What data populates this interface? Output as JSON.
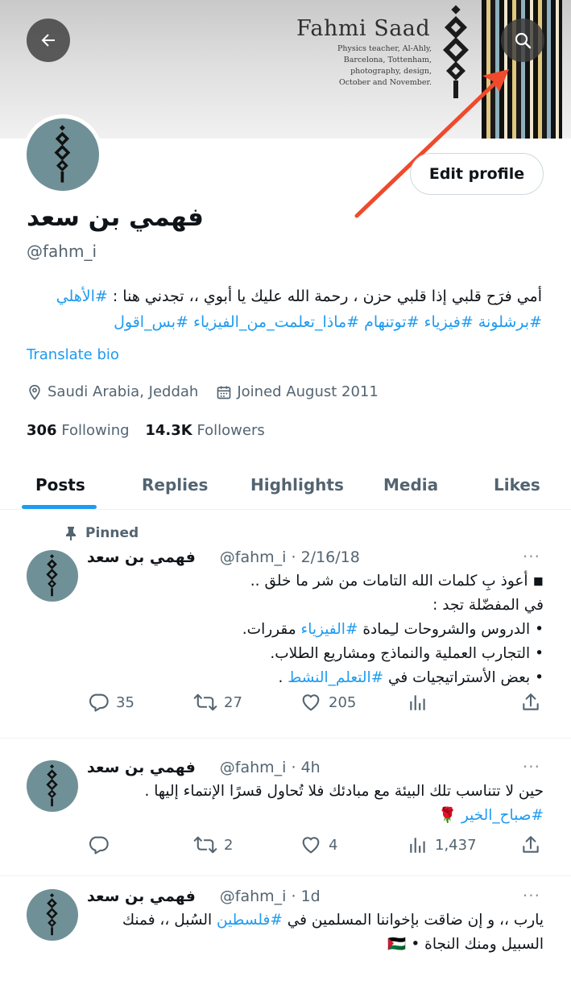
{
  "banner": {
    "name": "Fahmi Saad",
    "subtitle_lines": [
      "Physics teacher, Al-Ahly,",
      "Barcelona, Tottenham,",
      "photography, design,",
      "October and November."
    ]
  },
  "profile": {
    "edit_label": "Edit profile",
    "display_name": "فهمي بن سعد",
    "handle": "@fahm_i",
    "bio_line1_text": "أمي فرَح قلبي إذا قلبي حزن ، رحمة الله عليك يا أبوي ،، تجدني هنا : ",
    "bio_line1_tag": "#الأهلي",
    "bio_line2": "#برشلونة #فيزياء #توتنهام #ماذا_تعلمت_من_الفيزياء #بس_اقول",
    "translate": "Translate bio",
    "location": "Saudi Arabia, Jeddah",
    "joined": "Joined August 2011",
    "following_count": "306",
    "following_label": "Following",
    "followers_count": "14.3K",
    "followers_label": "Followers"
  },
  "tabs": [
    {
      "label": "Posts",
      "active": true
    },
    {
      "label": "Replies",
      "active": false
    },
    {
      "label": "Highlights",
      "active": false
    },
    {
      "label": "Media",
      "active": false
    },
    {
      "label": "Likes",
      "active": false
    }
  ],
  "posts": [
    {
      "pinned_label": "Pinned",
      "name": "فهمي بن سعد",
      "meta": "@fahm_i · 2/16/18",
      "more": "···",
      "lines": [
        {
          "pre": "◾ أعوذ بِ كلمات الله التامات من شر ما خلق ..",
          "tag": "",
          "post": ""
        },
        {
          "pre": "في المفضّلة تجد :",
          "tag": "",
          "post": ""
        },
        {
          "pre": "• الدروس والشروحات لـِمادة ",
          "tag": "#الفيزياء",
          "post": " مقررات."
        },
        {
          "pre": "• التجارب العملية والنماذج ومشاريع الطلاب.",
          "tag": "",
          "post": ""
        },
        {
          "pre": "• بعض الأستراتيجيات في ",
          "tag": "#التعلم_النشط",
          "post": " ."
        }
      ],
      "replies": "35",
      "reposts": "27",
      "likes": "205",
      "views": ""
    },
    {
      "name": "فهمي بن سعد",
      "meta": "@fahm_i · 4h",
      "more": "···",
      "lines": [
        {
          "pre": "حين لا تتناسب تلك البيئة مع مبادئك فلا تُحاول قسرًا الإنتماء إليها .",
          "tag": "",
          "post": ""
        },
        {
          "pre": "",
          "tag": "#صباح_الخير",
          "post": " 🌹"
        }
      ],
      "replies": "",
      "reposts": "2",
      "likes": "4",
      "views": "1,437"
    },
    {
      "name": "فهمي بن سعد",
      "meta": "@fahm_i · 1d",
      "more": "···",
      "lines": [
        {
          "pre": "يارب ،، و إن ضاقت بإخواننا المسلمين في ",
          "tag": "#فلسطين",
          "post": " السُبل ،، فمنك"
        },
        {
          "pre": "السبيل ومنك النجاة • 🇵🇸",
          "tag": "",
          "post": ""
        }
      ]
    }
  ],
  "icons": {
    "back": "arrow-left-icon",
    "search": "search-icon",
    "location": "location-pin-icon",
    "calendar": "calendar-icon",
    "pin": "pin-icon",
    "reply": "reply-icon",
    "repost": "repost-icon",
    "like": "heart-icon",
    "views": "views-icon",
    "share": "share-icon"
  },
  "colors": {
    "accent": "#1d9bf0",
    "text": "#0f1419",
    "muted": "#536471",
    "annotation_arrow": "#f0492b"
  }
}
